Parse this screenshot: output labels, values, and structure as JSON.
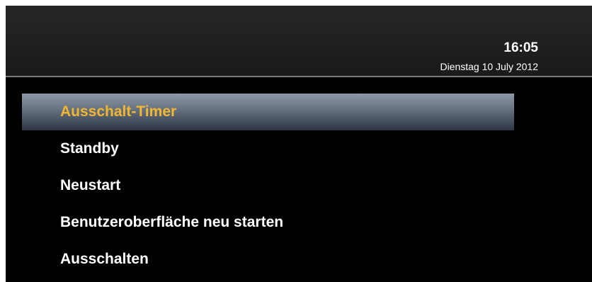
{
  "header": {
    "time": "16:05",
    "date": "Dienstag 10 July 2012"
  },
  "menu": {
    "selected_index": 0,
    "items": [
      {
        "label": "Ausschalt-Timer"
      },
      {
        "label": "Standby"
      },
      {
        "label": "Neustart"
      },
      {
        "label": "Benutzeroberfläche neu starten"
      },
      {
        "label": "Ausschalten"
      }
    ]
  },
  "colors": {
    "background": "#000000",
    "selected_text": "#f2b632",
    "text": "#ffffff"
  }
}
